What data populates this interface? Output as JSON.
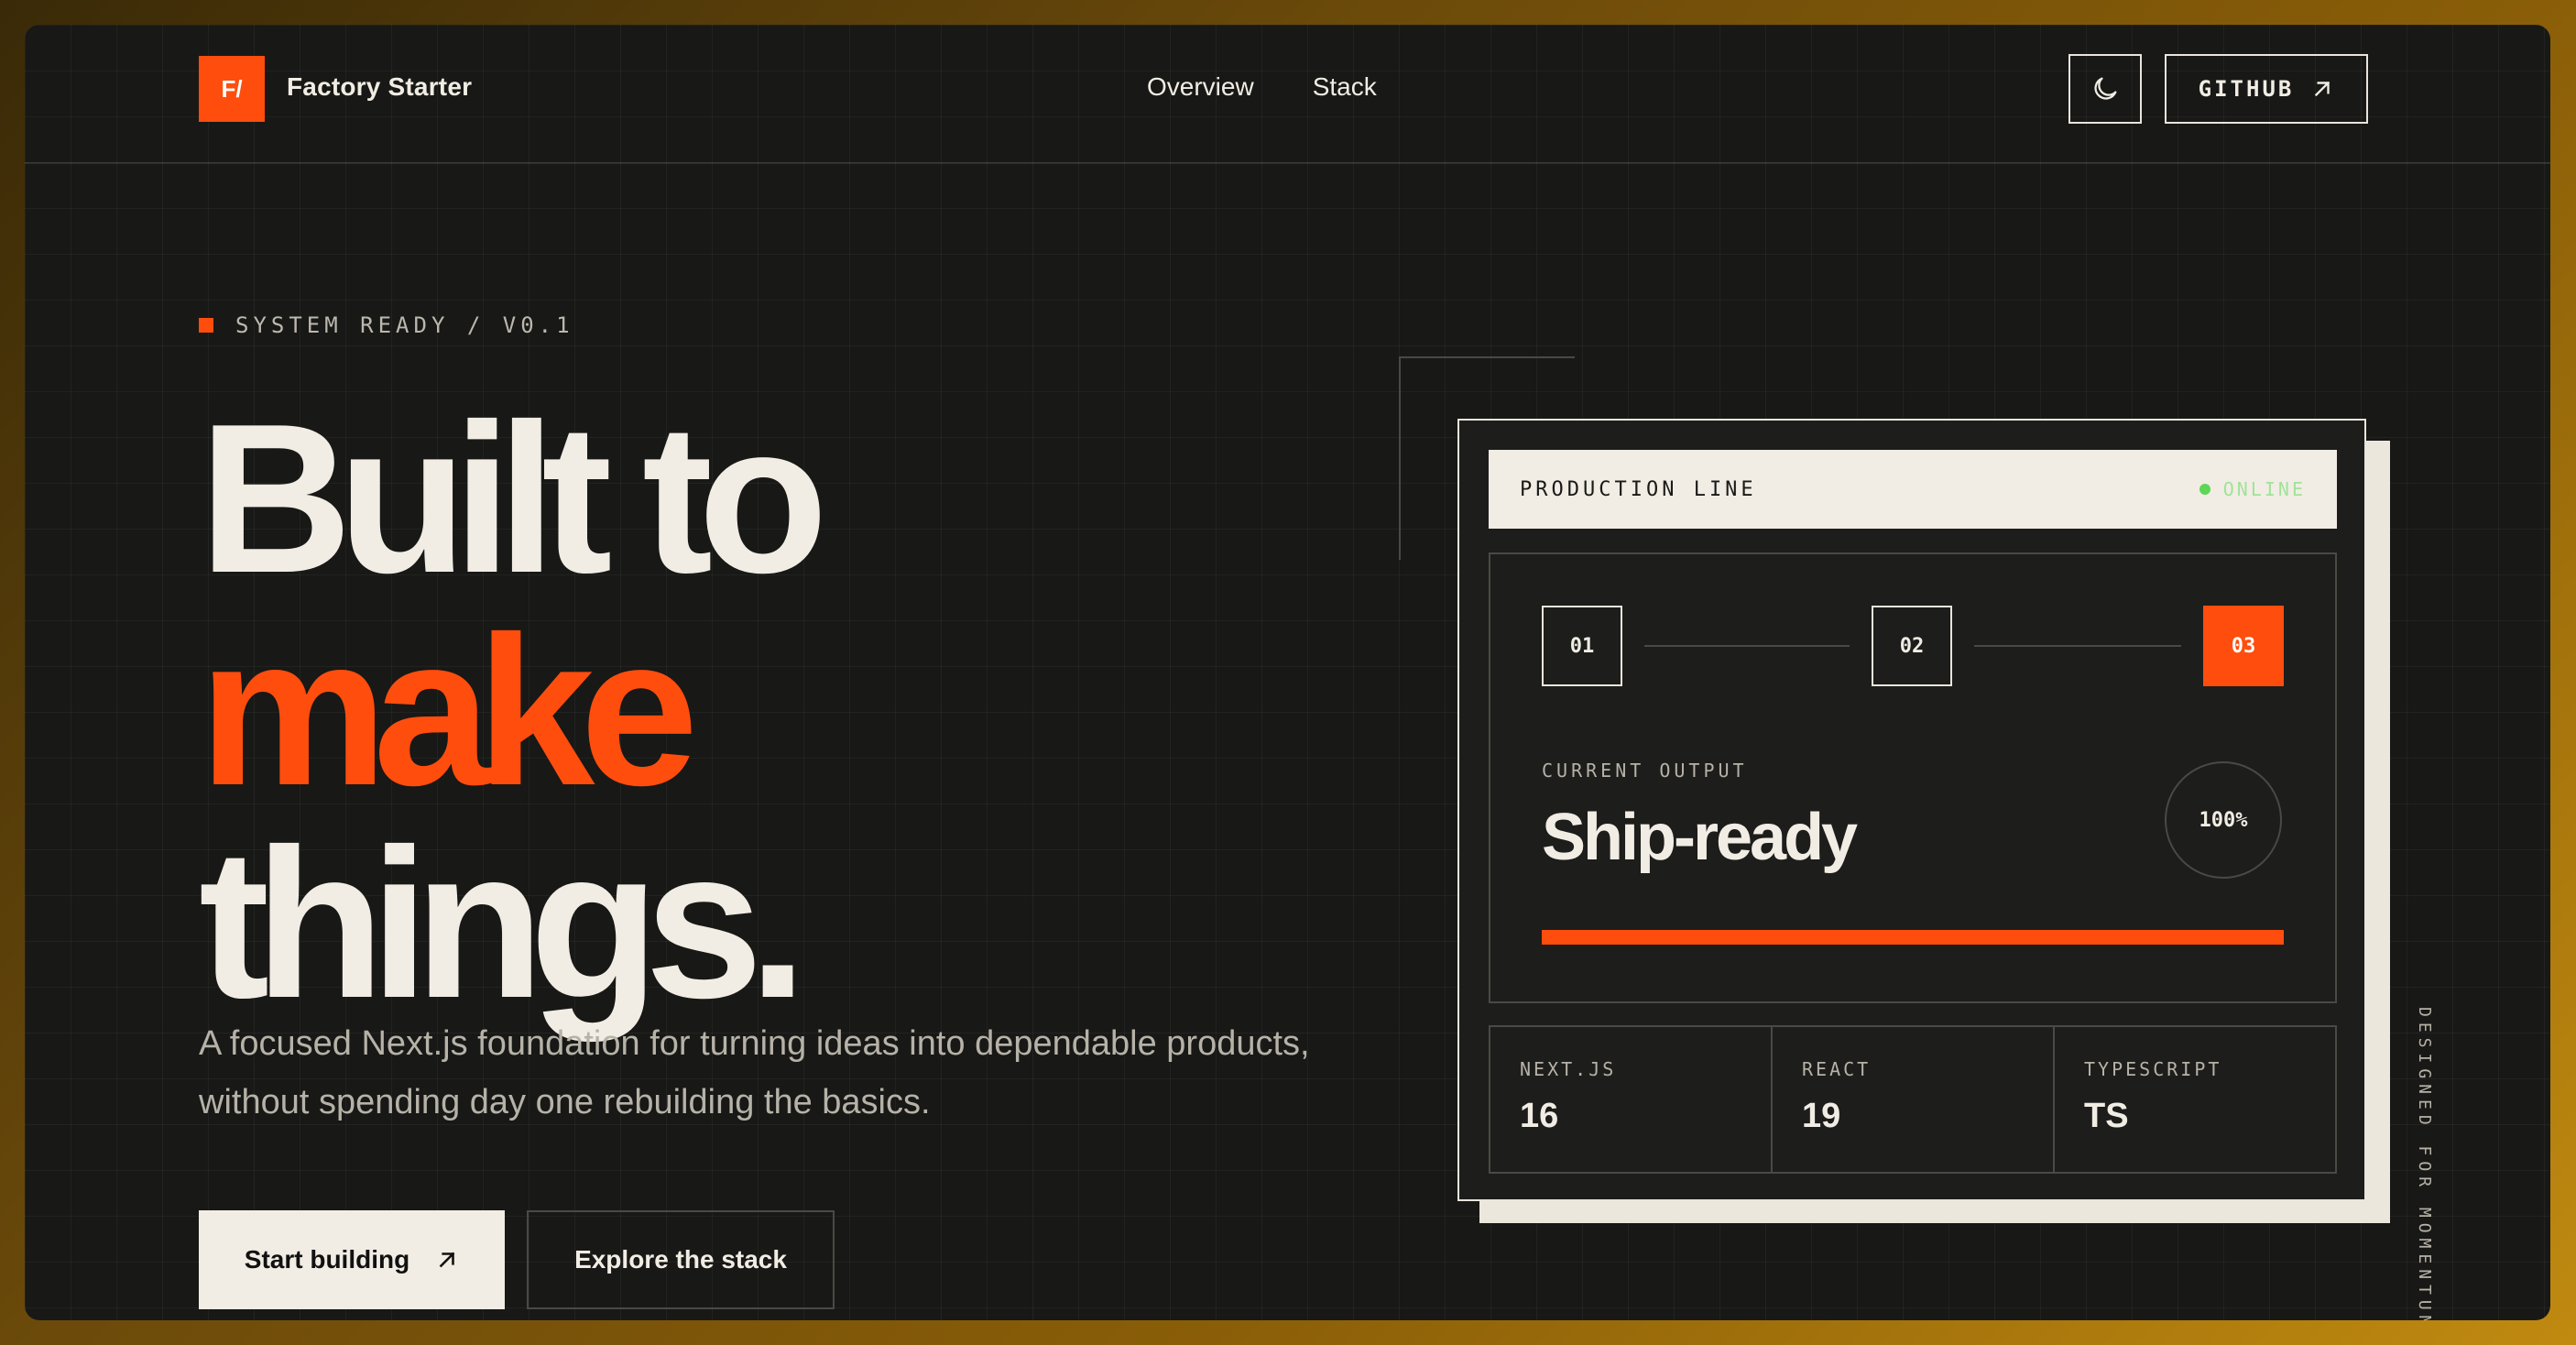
{
  "header": {
    "logo_text": "F/",
    "brand": "Factory Starter",
    "nav": [
      {
        "label": "Overview"
      },
      {
        "label": "Stack"
      }
    ],
    "github_label": "GITHUB",
    "theme_toggle_icon": "moon-icon"
  },
  "hero": {
    "eyebrow": "SYSTEM READY / V0.1",
    "headline_line1": "Built to",
    "headline_line2": "make",
    "headline_line3": "things.",
    "lede": "A focused Next.js foundation for turning ideas into dependable products, without spending day one rebuilding the basics.",
    "primary_cta": "Start building",
    "secondary_cta": "Explore the stack"
  },
  "card": {
    "title": "PRODUCTION LINE",
    "status": "ONLINE",
    "steps": [
      {
        "label": "01",
        "active": false
      },
      {
        "label": "02",
        "active": false
      },
      {
        "label": "03",
        "active": true
      }
    ],
    "output_label": "CURRENT OUTPUT",
    "output_value": "Ship-ready",
    "progress_label": "100%",
    "progress": 1.0,
    "stats": [
      {
        "key": "NEXT.JS",
        "value": "16"
      },
      {
        "key": "REACT",
        "value": "19"
      },
      {
        "key": "TYPESCRIPT",
        "value": "TS"
      }
    ]
  },
  "side_text": "DESIGNED FOR MOMENTUM",
  "colors": {
    "accent": "#ff4d0d",
    "background": "#181816",
    "foreground": "#f1ede4",
    "status_online": "#5ed656"
  }
}
